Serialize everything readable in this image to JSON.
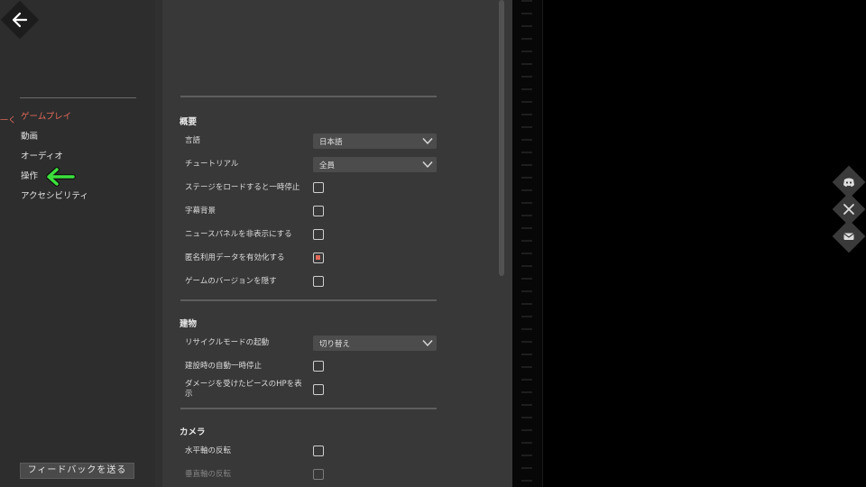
{
  "sidebar": {
    "back_icon": "arrow-left-icon",
    "nav": [
      {
        "label": "ゲームプレイ",
        "active": true
      },
      {
        "label": "動画"
      },
      {
        "label": "オーディオ"
      },
      {
        "label": "操作"
      },
      {
        "label": "アクセシビリティ"
      }
    ],
    "feedback_label": "フィードバックを送る"
  },
  "settings": {
    "overview": {
      "title": "概要",
      "language_label": "言語",
      "language_value": "日本語",
      "tutorial_label": "チュートリアル",
      "tutorial_value": "全員",
      "pause_on_load_label": "ステージをロードすると一時停止",
      "subtitle_bg_label": "字幕背景",
      "hide_news_label": "ニュースパネルを非表示にする",
      "anon_data_label": "匿名利用データを有効化する",
      "hide_version_label": "ゲームのバージョンを隠す"
    },
    "building": {
      "title": "建物",
      "recycle_label": "リサイクルモードの起動",
      "recycle_value": "切り替え",
      "auto_pause_label": "建設時の自動一時停止",
      "damage_hp_label": "ダメージを受けたピースのHPを表示"
    },
    "camera": {
      "title": "カメラ",
      "invert_h_label": "水平軸の反転",
      "invert_v_label": "垂直軸の反転"
    }
  },
  "social": [
    "discord-icon",
    "x-icon",
    "mail-icon"
  ],
  "colors": {
    "accent": "#e06a5a",
    "highlight_arrow": "#3ce03c"
  }
}
